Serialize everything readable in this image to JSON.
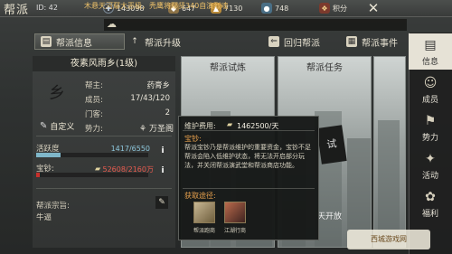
{
  "header": {
    "title": "帮派",
    "id_label": "ID: 42",
    "resources": [
      {
        "icon": "silver-coin-icon",
        "value": "143098"
      },
      {
        "icon": "gold-icon",
        "value": "647"
      },
      {
        "icon": "ingot-icon",
        "value": "7130"
      },
      {
        "icon": "jade-icon",
        "value": "748"
      },
      {
        "icon": "points-icon",
        "value": "积分"
      }
    ]
  },
  "notice": "木悬天河鄢大恶极，秃鹰将鄢贤340自演烈魂",
  "tabs": [
    {
      "label": "帮派信息",
      "active": true
    },
    {
      "label": "帮派升级"
    },
    {
      "label": "回归帮派"
    },
    {
      "label": "帮派事件"
    }
  ],
  "sidebar": [
    {
      "label": "信息",
      "icon": "guild-info-icon"
    },
    {
      "label": "成员",
      "icon": "members-icon"
    },
    {
      "label": "势力",
      "icon": "power-icon"
    },
    {
      "label": "活动",
      "icon": "activity-icon"
    },
    {
      "label": "福利",
      "icon": "welfare-icon"
    }
  ],
  "guild": {
    "name": "夜素风雨乡(1级)",
    "emblem_text": "乡",
    "leader_label": "帮主:",
    "leader": "药膏乡",
    "members_label": "成员:",
    "members": "17/43/120",
    "guests_label": "门客:",
    "guests": "2",
    "power_label": "势力:",
    "power": "万圣阁",
    "custom_btn": "自定义",
    "activity_label": "活跃度",
    "activity_value": "1417/6550",
    "activity_ratio": 0.216,
    "funds_label": "宝钞:",
    "funds_value": "52608/2160万",
    "motto_label": "帮派宗旨:",
    "motto": "牛逼"
  },
  "cards": [
    {
      "title": "帮派试炼"
    },
    {
      "title": "帮派任务",
      "caption": "天开放",
      "stamp": "试"
    }
  ],
  "popup": {
    "maintenance_label": "维护费用:",
    "maintenance_value": "1462500/天",
    "sub_title": "宝钞:",
    "description": "帮派宝钞乃是帮派维护的重要资金，宝钞不足帮派会陷入低维护状态，将无法开启部分玩法，并关闭帮派演武堂和帮派商店功能。",
    "acquire_label": "获取途径:",
    "acquire_items": [
      {
        "label": "帮派跑商"
      },
      {
        "label": "江湖行商"
      }
    ]
  },
  "watermark": "西城游戏网"
}
